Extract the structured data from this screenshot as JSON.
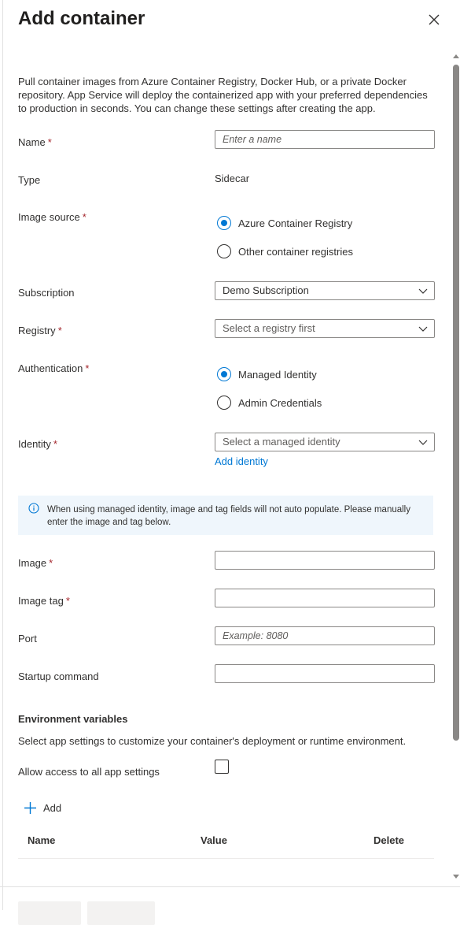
{
  "panel": {
    "title": "Add container",
    "description": "Pull container images from Azure Container Registry, Docker Hub, or a private Docker repository. App Service will deploy the containerized app with your preferred dependencies to production in seconds. You can change these settings after creating the app."
  },
  "form": {
    "name": {
      "label": "Name",
      "placeholder": "Enter a name",
      "required": true
    },
    "type": {
      "label": "Type",
      "value": "Sidecar"
    },
    "image_source": {
      "label": "Image source",
      "required": true,
      "options": [
        "Azure Container Registry",
        "Other container registries"
      ],
      "selected": "Azure Container Registry"
    },
    "subscription": {
      "label": "Subscription",
      "value": "Demo Subscription"
    },
    "registry": {
      "label": "Registry",
      "value": "Select a registry first",
      "required": true
    },
    "authentication": {
      "label": "Authentication",
      "required": true,
      "options": [
        "Managed Identity",
        "Admin Credentials"
      ],
      "selected": "Managed Identity"
    },
    "identity": {
      "label": "Identity",
      "value": "Select a managed identity",
      "required": true,
      "link": "Add identity"
    },
    "info": "When using managed identity, image and tag fields will not auto populate. Please manually enter the image and tag below.",
    "image": {
      "label": "Image",
      "value": "",
      "required": true
    },
    "image_tag": {
      "label": "Image tag",
      "value": "",
      "required": true
    },
    "port": {
      "label": "Port",
      "placeholder": "Example: 8080"
    },
    "startup": {
      "label": "Startup command",
      "value": ""
    }
  },
  "env": {
    "title": "Environment variables",
    "description": "Select app settings to customize your container's deployment or runtime environment.",
    "allow_label": "Allow access to all app settings",
    "allow_checked": false,
    "add_label": "Add",
    "columns": [
      "Name",
      "Value",
      "Delete"
    ]
  },
  "colors": {
    "accent": "#0078d4",
    "required": "#a4262c",
    "info_bg": "#eff6fc"
  }
}
